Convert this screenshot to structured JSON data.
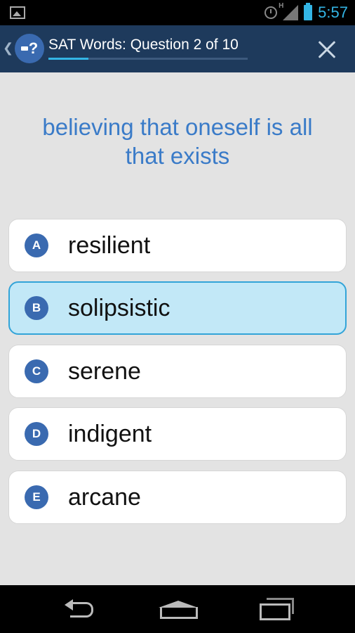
{
  "status_bar": {
    "network_label": "H",
    "time": "5:57"
  },
  "action_bar": {
    "logo_glyph": "?",
    "title": "SAT Words: Question 2 of 10",
    "progress_fraction": 0.2
  },
  "question": {
    "text": "believing that oneself is all that exists"
  },
  "answers": [
    {
      "letter": "A",
      "text": "resilient",
      "selected": false
    },
    {
      "letter": "B",
      "text": "solipsistic",
      "selected": true
    },
    {
      "letter": "C",
      "text": "serene",
      "selected": false
    },
    {
      "letter": "D",
      "text": "indigent",
      "selected": false
    },
    {
      "letter": "E",
      "text": "arcane",
      "selected": false
    }
  ],
  "icons": {
    "status": [
      "image-icon",
      "alarm-icon",
      "signal-icon",
      "battery-icon"
    ],
    "action_bar": [
      "back-chevron-icon",
      "app-logo-icon",
      "close-icon"
    ],
    "nav": [
      "back-icon",
      "home-icon",
      "recent-apps-icon"
    ]
  },
  "colors": {
    "action_bar": "#1e3a5c",
    "accent": "#33b5e5",
    "question_text": "#3a7bc8",
    "badge": "#3a6ab0",
    "selected_bg": "#c2e8f7"
  }
}
